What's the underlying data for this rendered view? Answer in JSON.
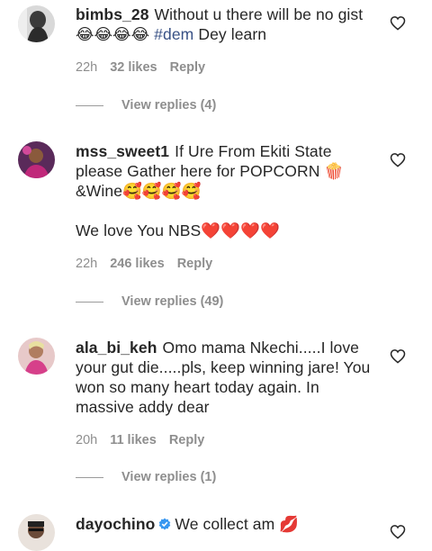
{
  "comments": [
    {
      "username": "bimbs_28",
      "text": "Without u there will be no gist 😂😂😂😂",
      "hashtag": "#dem",
      "text_after": "Dey learn",
      "time": "22h",
      "likes": "32 likes",
      "reply": "Reply",
      "view_replies": "View replies (4)"
    },
    {
      "username": "mss_sweet1",
      "text": "If Ure From Ekiti State please Gather here for POPCORN 🍿 &Wine🥰🥰🥰🥰",
      "text2": "We love You NBS❤️❤️❤️❤️",
      "time": "22h",
      "likes": "246 likes",
      "reply": "Reply",
      "view_replies": "View replies (49)"
    },
    {
      "username": "ala_bi_keh",
      "text": "Omo mama Nkechi.....I love your gut die.....pls, keep winning jare! You won so many heart today again. In massive addy dear",
      "time": "20h",
      "likes": "11 likes",
      "reply": "Reply",
      "view_replies": "View replies (1)"
    },
    {
      "username": "dayochino",
      "text": "We collect am 💋"
    }
  ],
  "colors": {
    "hashtag": "#385185",
    "verified": "#3897f0",
    "muted": "#8e8e8e"
  },
  "icons": {
    "like": "heart-outline-icon",
    "verified": "verified-badge-icon"
  }
}
